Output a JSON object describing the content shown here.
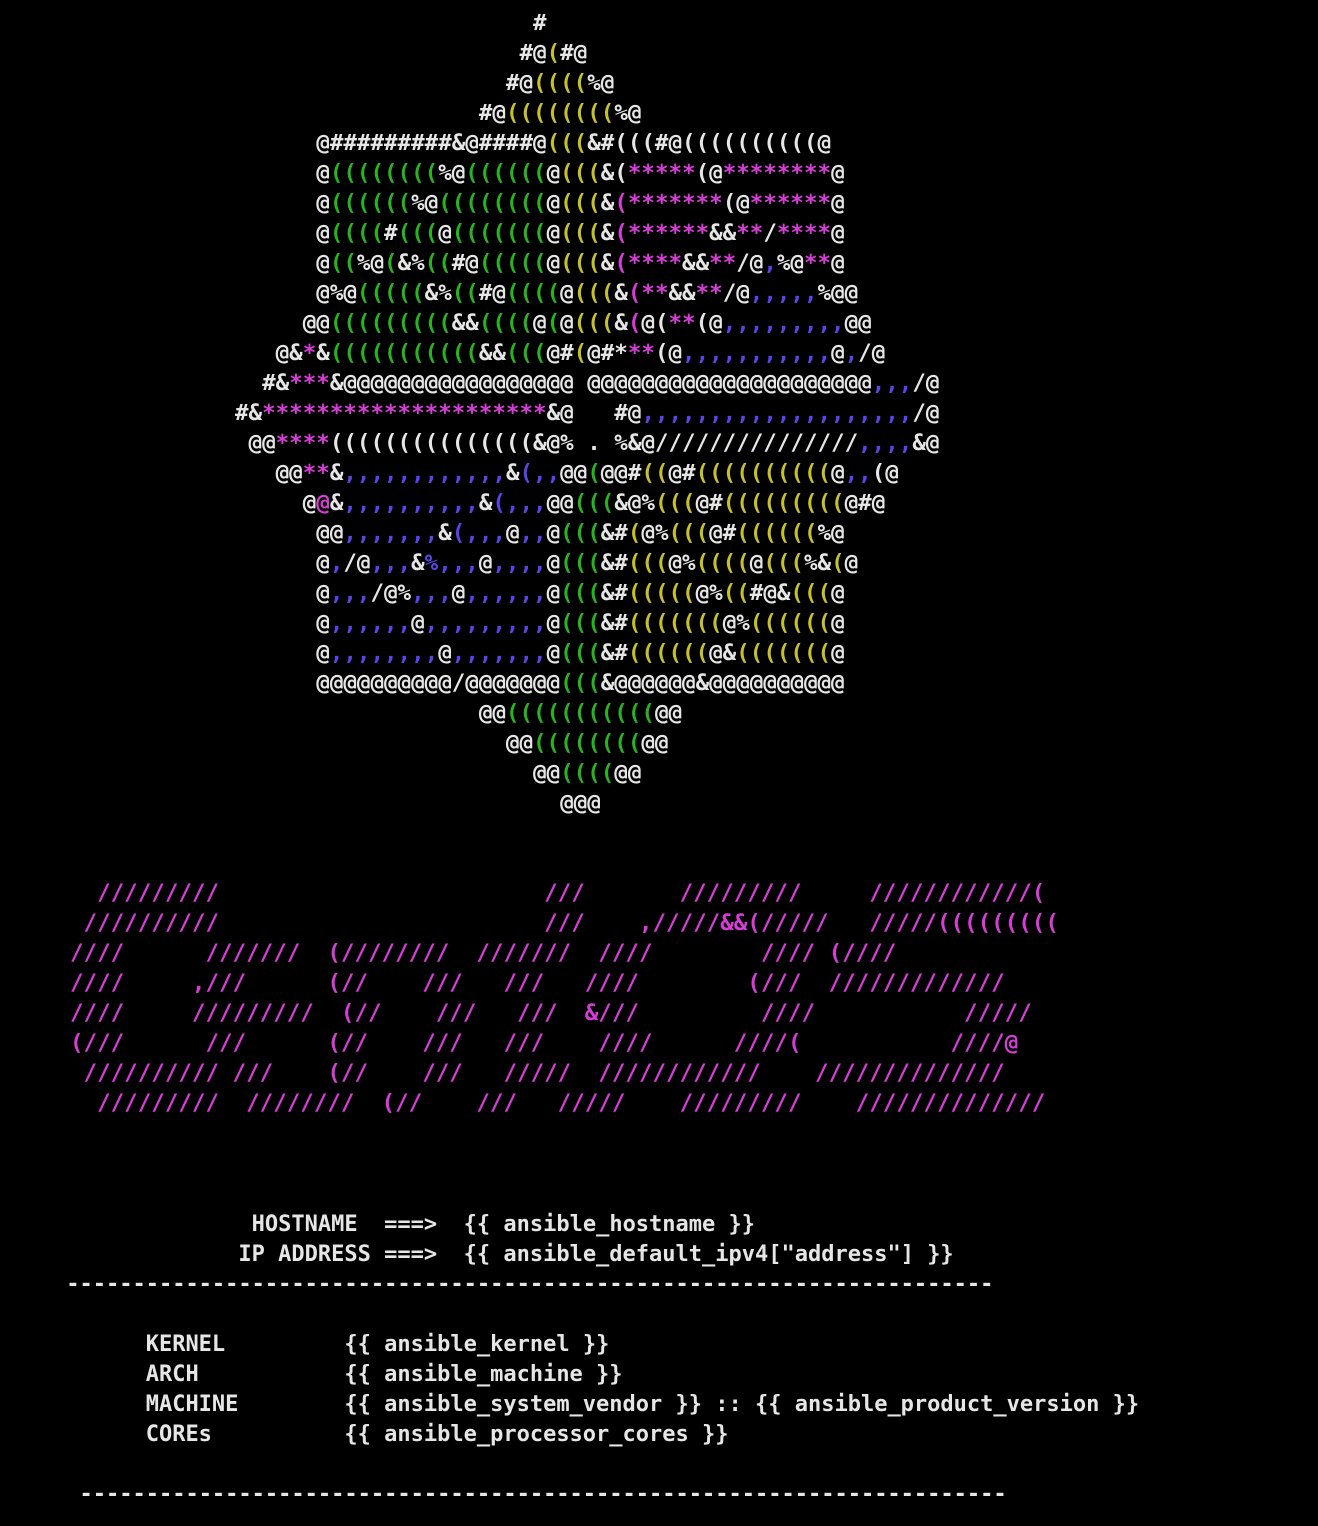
{
  "logo": {
    "name": "centos-ascii-logo",
    "colors": {
      "text": "#e6e6e6",
      "green": "#28b41e",
      "yellow": "#c6c12a",
      "magenta": "#d63ed6",
      "blue": "#5a46e8",
      "background": "#000000"
    }
  },
  "wordmark": {
    "name": "centos-ascii-wordmark",
    "color": "#d63ed6"
  },
  "header": {
    "hostname_label": "HOSTNAME",
    "hostname_arrow": "===>",
    "hostname_value": "{{ ansible_hostname }}",
    "ip_label": "IP ADDRESS",
    "ip_arrow": "===>",
    "ip_value": "{{ ansible_default_ipv4[\"address\"] }}"
  },
  "separator_top": "----------------------------------------------------------------------",
  "system_info": [
    {
      "label": "KERNEL",
      "value": "{{ ansible_kernel }}"
    },
    {
      "label": "ARCH",
      "value": "{{ ansible_machine }}"
    },
    {
      "label": "MACHINE",
      "value": "{{ ansible_system_vendor }} :: {{ ansible_product_version }}"
    },
    {
      "label": "COREs",
      "value": "{{ ansible_processor_cores }}"
    }
  ],
  "separator_bottom": "----------------------------------------------------------------------"
}
